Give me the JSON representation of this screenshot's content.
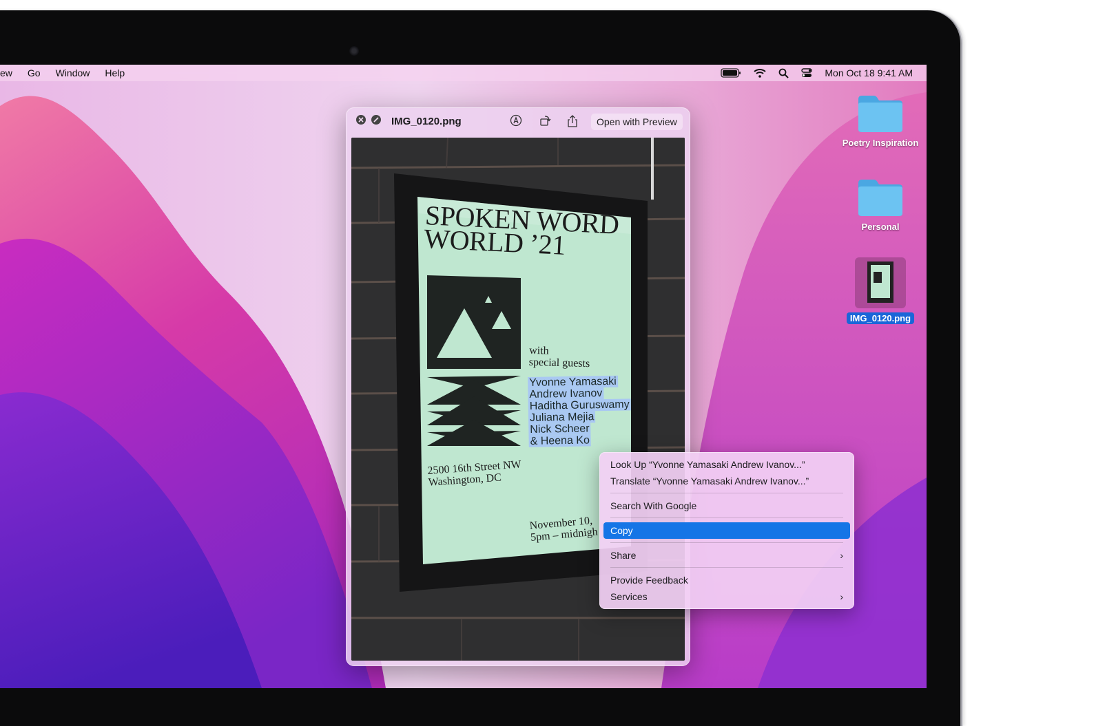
{
  "menubar": {
    "items": [
      "ew",
      "Go",
      "Window",
      "Help"
    ],
    "clock": "Mon Oct 18  9:41 AM"
  },
  "quicklook": {
    "title": "IMG_0120.png",
    "open_button": "Open with Preview"
  },
  "poster": {
    "title_line1": "SPOKEN WORD",
    "title_line2": "WORLD ’21",
    "with": "with",
    "special": "special guests",
    "guests": [
      "Yvonne Yamasaki",
      "Andrew Ivanov",
      "Haditha Guruswamy",
      "Juliana Mejia",
      "Nick Scheer",
      "& Heena Ko"
    ],
    "address1": "2500 16th Street NW",
    "address2": "Washington, DC",
    "date1": "November 10,",
    "date2": "5pm – midnigh"
  },
  "context_menu": {
    "lookup": "Look Up “Yvonne Yamasaki Andrew Ivanov...”",
    "translate": "Translate “Yvonne Yamasaki Andrew Ivanov...”",
    "search": "Search With Google",
    "copy": "Copy",
    "share": "Share",
    "feedback": "Provide Feedback",
    "services": "Services"
  },
  "desktop": {
    "folder1": "Poetry Inspiration",
    "folder2": "Personal",
    "file": "IMG_0120.png"
  },
  "colors": {
    "folder": "#5fb8ee",
    "selection": "#1575e6",
    "highlight": "#a9c8f2",
    "poster_bg": "#bfe7d0"
  }
}
